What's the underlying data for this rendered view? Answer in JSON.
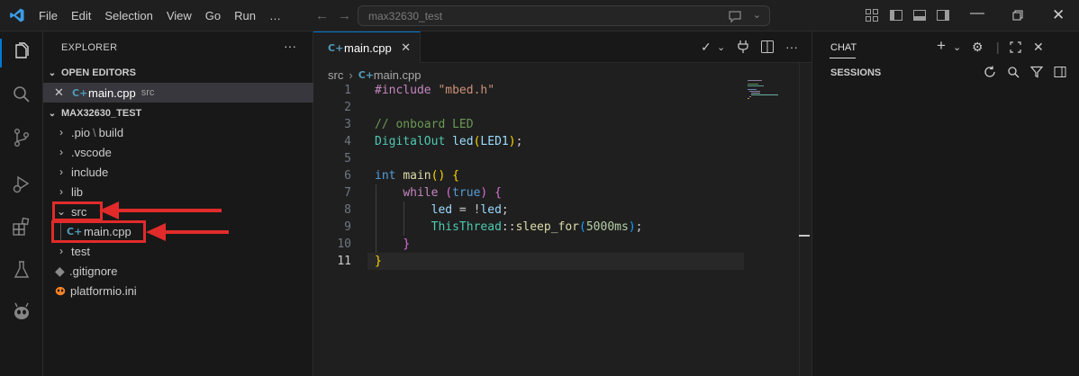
{
  "menu": [
    "File",
    "Edit",
    "Selection",
    "View",
    "Go",
    "Run",
    "…"
  ],
  "search": {
    "text": "max32630_test"
  },
  "explorer": {
    "title": "EXPLORER",
    "more": "···",
    "open_editors": {
      "label": "OPEN EDITORS",
      "items": [
        {
          "name": "main.cpp",
          "folder": "src"
        }
      ]
    },
    "project": {
      "label": "MAX32630_TEST",
      "tree": [
        {
          "name": ".pio",
          "extra": "build",
          "type": "folder"
        },
        {
          "name": ".vscode",
          "type": "folder"
        },
        {
          "name": "include",
          "type": "folder"
        },
        {
          "name": "lib",
          "type": "folder"
        },
        {
          "name": "src",
          "type": "folder"
        },
        {
          "name": "main.cpp",
          "type": "file"
        },
        {
          "name": "test",
          "type": "folder"
        },
        {
          "name": ".gitignore",
          "type": "file"
        },
        {
          "name": "platformio.ini",
          "type": "file"
        }
      ]
    }
  },
  "editor": {
    "tab": "main.cpp",
    "breadcrumb": [
      "src",
      "main.cpp"
    ],
    "line_numbers": [
      "1",
      "2",
      "3",
      "4",
      "5",
      "6",
      "7",
      "8",
      "9",
      "10",
      "11"
    ],
    "current_line": "11",
    "lines": [
      "#include \"mbed.h\"",
      "",
      "// onboard LED",
      "DigitalOut led(LED1);",
      "",
      "int main() {",
      "    while (true) {",
      "        led = !led;",
      "        ThisThread::sleep_for(5000ms);",
      "    }",
      "}"
    ]
  },
  "chat": {
    "title": "CHAT",
    "sessions": "SESSIONS"
  },
  "colors": {
    "accent": "#0078d4",
    "annotation": "#e12b2b"
  }
}
